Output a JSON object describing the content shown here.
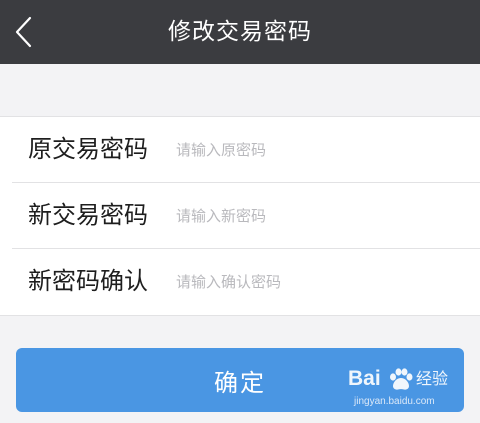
{
  "navbar": {
    "title": "修改交易密码",
    "back_icon": "chevron-left-icon",
    "background": "#3b3c40"
  },
  "form": {
    "rows": [
      {
        "label": "原交易密码",
        "placeholder": "请输入原密码",
        "value": ""
      },
      {
        "label": "新交易密码",
        "placeholder": "请输入新密码",
        "value": ""
      },
      {
        "label": "新密码确认",
        "placeholder": "请输入确认密码",
        "value": ""
      }
    ]
  },
  "confirm": {
    "label": "确定",
    "color": "#4a96e3"
  },
  "watermark": {
    "logo": "Bai",
    "logo_suffix": "经验",
    "url": "jingyan.baidu.com"
  }
}
